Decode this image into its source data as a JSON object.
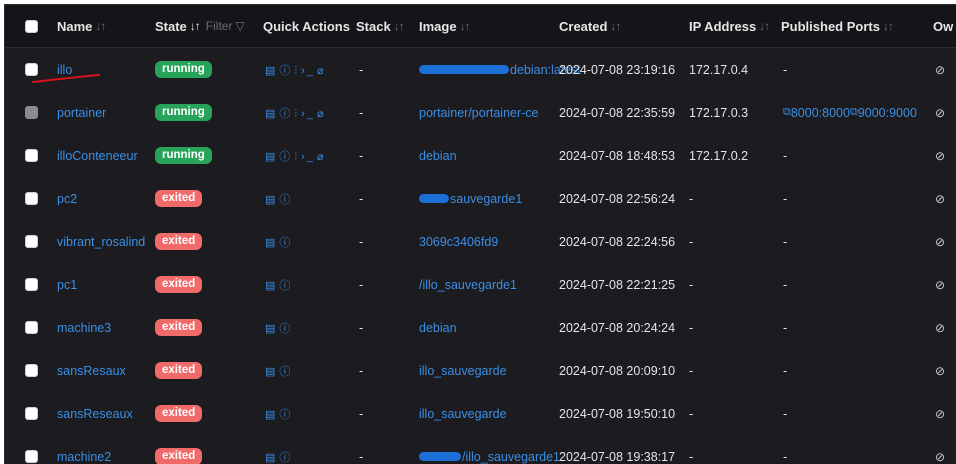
{
  "header": {
    "name": "Name",
    "name_sort": "↓↑",
    "state": "State",
    "state_sort": "↓↑",
    "filter": "Filter",
    "filter_icon": "▽",
    "quick_actions": "Quick Actions",
    "stack": "Stack",
    "stack_sort": "↓↑",
    "image": "Image",
    "image_sort": "↓↑",
    "created": "Created",
    "created_sort": "↓↑",
    "ip": "IP Address",
    "ip_sort": "↓↑",
    "ports": "Published Ports",
    "ports_sort": "↓↑",
    "ownership": "Ow"
  },
  "colors": {
    "running": "#27a35a",
    "exited": "#f06a6a",
    "link": "#3b8fe3",
    "annotation": "#d9141e",
    "redaction": "#1d6fd8"
  },
  "icons": {
    "quick_actions_full": [
      "logs-icon",
      "inspect-icon",
      "stats-icon",
      "console-icon",
      "attach-icon"
    ],
    "quick_actions_short": [
      "logs-icon",
      "inspect-icon"
    ],
    "ownership": "eye-slash-icon"
  },
  "rows": [
    {
      "name": "illo",
      "state": "running",
      "actions": "full",
      "stack": "-",
      "image": "debian:latest",
      "created": "2024-07-08 23:19:16",
      "ip": "172.17.0.4",
      "ports": "-",
      "selected": false
    },
    {
      "name": "portainer",
      "state": "running",
      "actions": "full",
      "stack": "-",
      "image": "portainer/portainer-ce",
      "created": "2024-07-08 22:35:59",
      "ip": "172.17.0.3",
      "ports": "8000:8000 9000:9000",
      "selected": true
    },
    {
      "name": "illoConteneeur",
      "state": "running",
      "actions": "full",
      "stack": "-",
      "image": "debian",
      "created": "2024-07-08 18:48:53",
      "ip": "172.17.0.2",
      "ports": "-",
      "selected": false
    },
    {
      "name": "pc2",
      "state": "exited",
      "actions": "short",
      "stack": "-",
      "image": "sauvegarde1",
      "created": "2024-07-08 22:56:24",
      "ip": "-",
      "ports": "-",
      "selected": false
    },
    {
      "name": "vibrant_rosalind",
      "state": "exited",
      "actions": "short",
      "stack": "-",
      "image": "3069c3406fd9",
      "created": "2024-07-08 22:24:56",
      "ip": "-",
      "ports": "-",
      "selected": false
    },
    {
      "name": "pc1",
      "state": "exited",
      "actions": "short",
      "stack": "-",
      "image": "/illo_sauvegarde1",
      "created": "2024-07-08 22:21:25",
      "ip": "-",
      "ports": "-",
      "selected": false
    },
    {
      "name": "machine3",
      "state": "exited",
      "actions": "short",
      "stack": "-",
      "image": "debian",
      "created": "2024-07-08 20:24:24",
      "ip": "-",
      "ports": "-",
      "selected": false
    },
    {
      "name": "sansResaux",
      "state": "exited",
      "actions": "short",
      "stack": "-",
      "image": "illo_sauvegarde",
      "created": "2024-07-08 20:09:10",
      "ip": "-",
      "ports": "-",
      "selected": false
    },
    {
      "name": "sansReseaux",
      "state": "exited",
      "actions": "short",
      "stack": "-",
      "image": "illo_sauvegarde",
      "created": "2024-07-08 19:50:10",
      "ip": "-",
      "ports": "-",
      "selected": false
    },
    {
      "name": "machine2",
      "state": "exited",
      "actions": "short",
      "stack": "-",
      "image": "/illo_sauvegarde1",
      "created": "2024-07-08 19:38:17",
      "ip": "-",
      "ports": "-",
      "selected": false
    }
  ]
}
